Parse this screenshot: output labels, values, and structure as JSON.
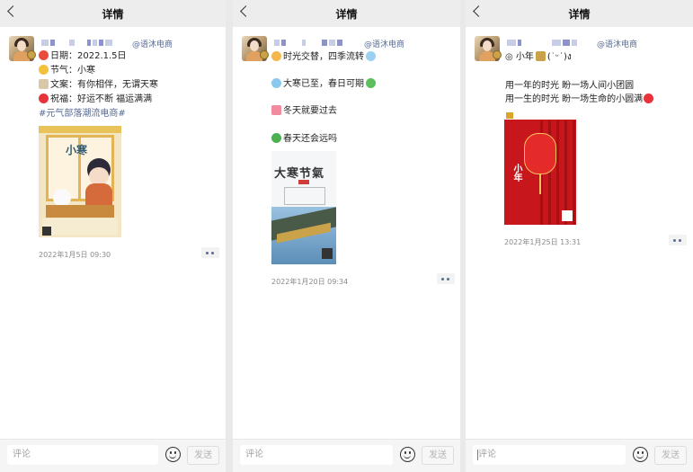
{
  "screen_title": "详情",
  "posts": [
    {
      "tag": "@语沐电商",
      "lines": [
        "日期：2022.1.5日",
        "节气：小寒",
        "文案：有你相伴，无谓天寒",
        "祝福：好运不断 福运满满"
      ],
      "hashtag": "#元气部落潮流电商#",
      "poster_text": "小寒",
      "time": "2022年1月5日 09:30"
    },
    {
      "tag": "@语沐电商",
      "lines": [
        "时光交替，四季流转",
        "大寒已至，春日可期",
        "冬天就要过去",
        "春天还会远吗"
      ],
      "poster_text": "大寒节氣",
      "time": "2022年1月20日 09:34"
    },
    {
      "tag": "@语沐电商",
      "lines": [
        "◎ 小年",
        "(˙ᵕ˙)ง",
        "用一年的时光 盼一场人间小团圆",
        "用一生的时光 盼一场生命的小圆满"
      ],
      "poster_text": "小年",
      "time": "2022年1月25日 13:31"
    }
  ],
  "comment_bar": {
    "placeholder": "评论",
    "send_label": "发送"
  },
  "colors": {
    "link": "#576b95",
    "header_bg": "#ededed",
    "heart": "#e8333a"
  }
}
